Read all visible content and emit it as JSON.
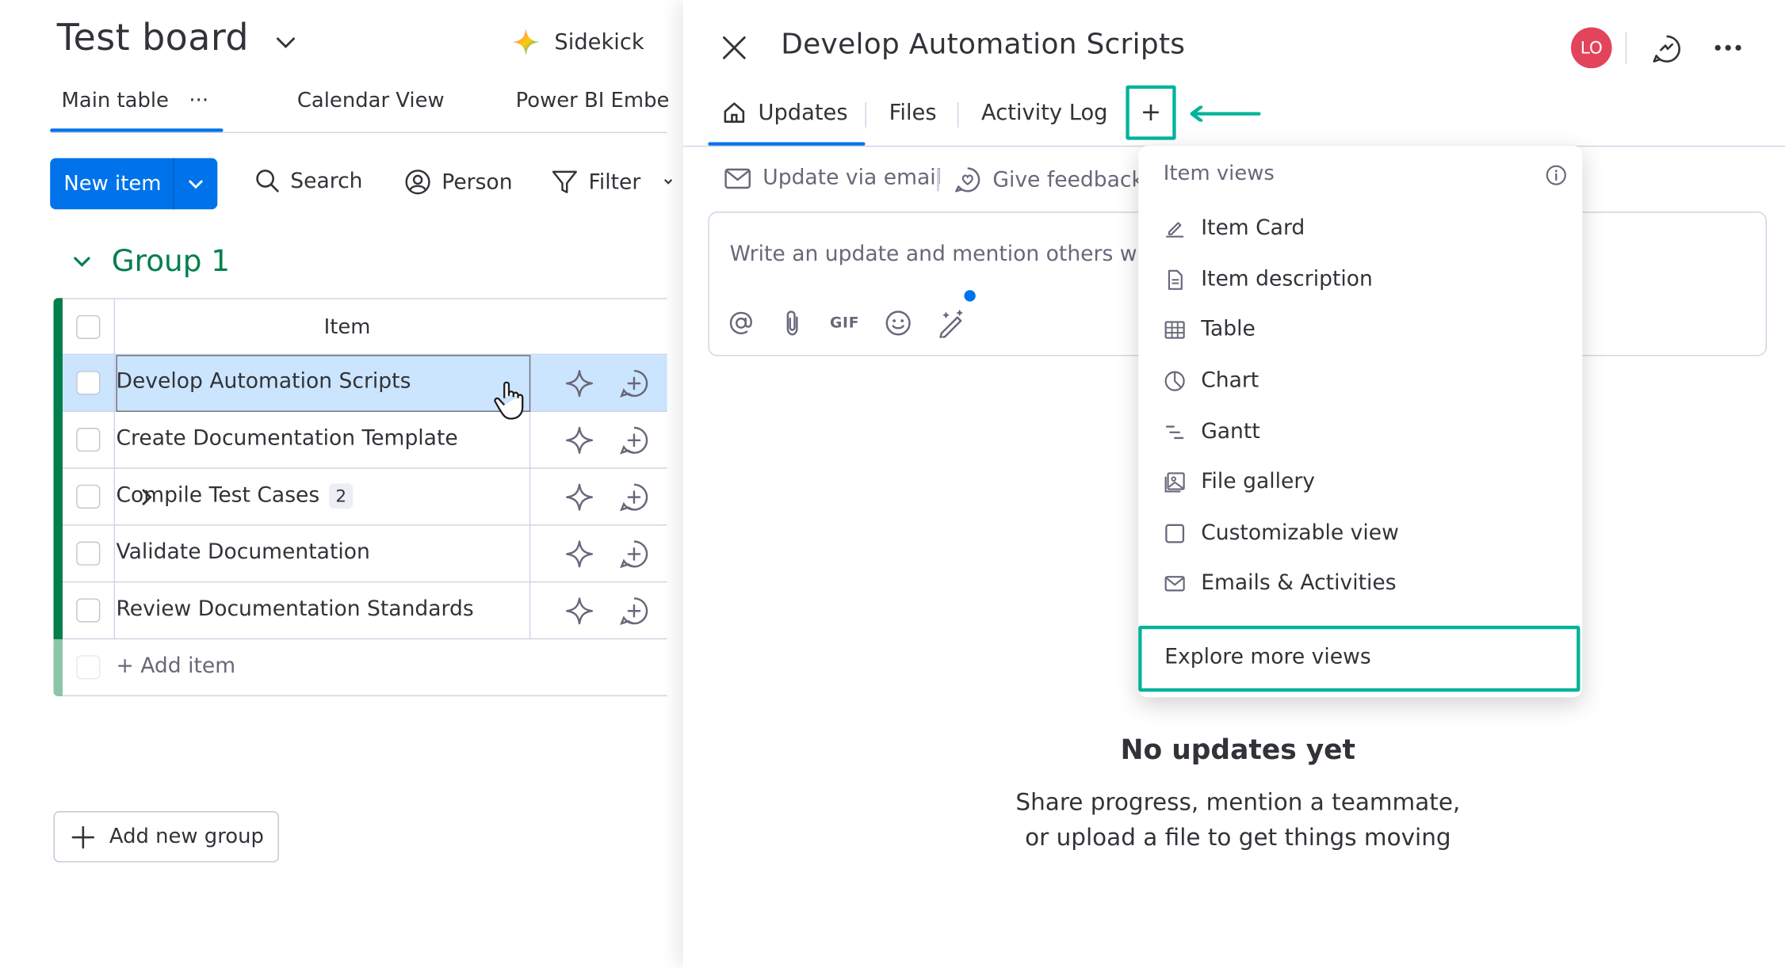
{
  "board": {
    "title": "Test board",
    "sidekick_label": "Sidekick",
    "tabs": [
      {
        "label": "Main table",
        "more": "···"
      },
      {
        "label": "Calendar View"
      },
      {
        "label": "Power BI Embe"
      }
    ],
    "toolbar": {
      "new_item_label": "New item",
      "search_label": "Search",
      "person_label": "Person",
      "filter_label": "Filter"
    },
    "group": {
      "title": "Group 1",
      "color": "#037f4c",
      "column_header": "Item",
      "rows": [
        {
          "name": "Develop Automation Scripts",
          "selected": true
        },
        {
          "name": "Create Documentation Template"
        },
        {
          "name": "Compile Test Cases",
          "subitem_count": "2"
        },
        {
          "name": "Validate Documentation"
        },
        {
          "name": "Review Documentation Standards"
        }
      ],
      "add_item_label": "+ Add item"
    },
    "add_group_label": "Add new group"
  },
  "panel": {
    "title": "Develop Automation Scripts",
    "avatar_initials": "LO",
    "avatar_color": "#e2445c",
    "tabs": [
      {
        "label": "Updates",
        "active": true
      },
      {
        "label": "Files"
      },
      {
        "label": "Activity Log"
      }
    ],
    "add_view_symbol": "+",
    "actions": {
      "update_via_email": "Update via email",
      "give_feedback": "Give feedback"
    },
    "editor_placeholder": "Write an update and mention others with",
    "gif_label": "GIF",
    "empty_title": "No updates yet",
    "empty_line1": "Share progress, mention a teammate,",
    "empty_line2": "or upload a file to get things moving"
  },
  "menu": {
    "heading": "Item views",
    "items": [
      {
        "label": "Item Card",
        "icon": "pencil-card-icon"
      },
      {
        "label": "Item description",
        "icon": "document-icon"
      },
      {
        "label": "Table",
        "icon": "table-icon"
      },
      {
        "label": "Chart",
        "icon": "pie-chart-icon"
      },
      {
        "label": "Gantt",
        "icon": "gantt-icon"
      },
      {
        "label": "File gallery",
        "icon": "image-gallery-icon"
      },
      {
        "label": "Customizable view",
        "icon": "square-icon"
      },
      {
        "label": "Emails & Activities",
        "icon": "mail-icon"
      }
    ],
    "explore_label": "Explore more views"
  },
  "colors": {
    "primary": "#0073ea",
    "highlight": "#00b39b",
    "selected_row": "#cce5ff"
  }
}
